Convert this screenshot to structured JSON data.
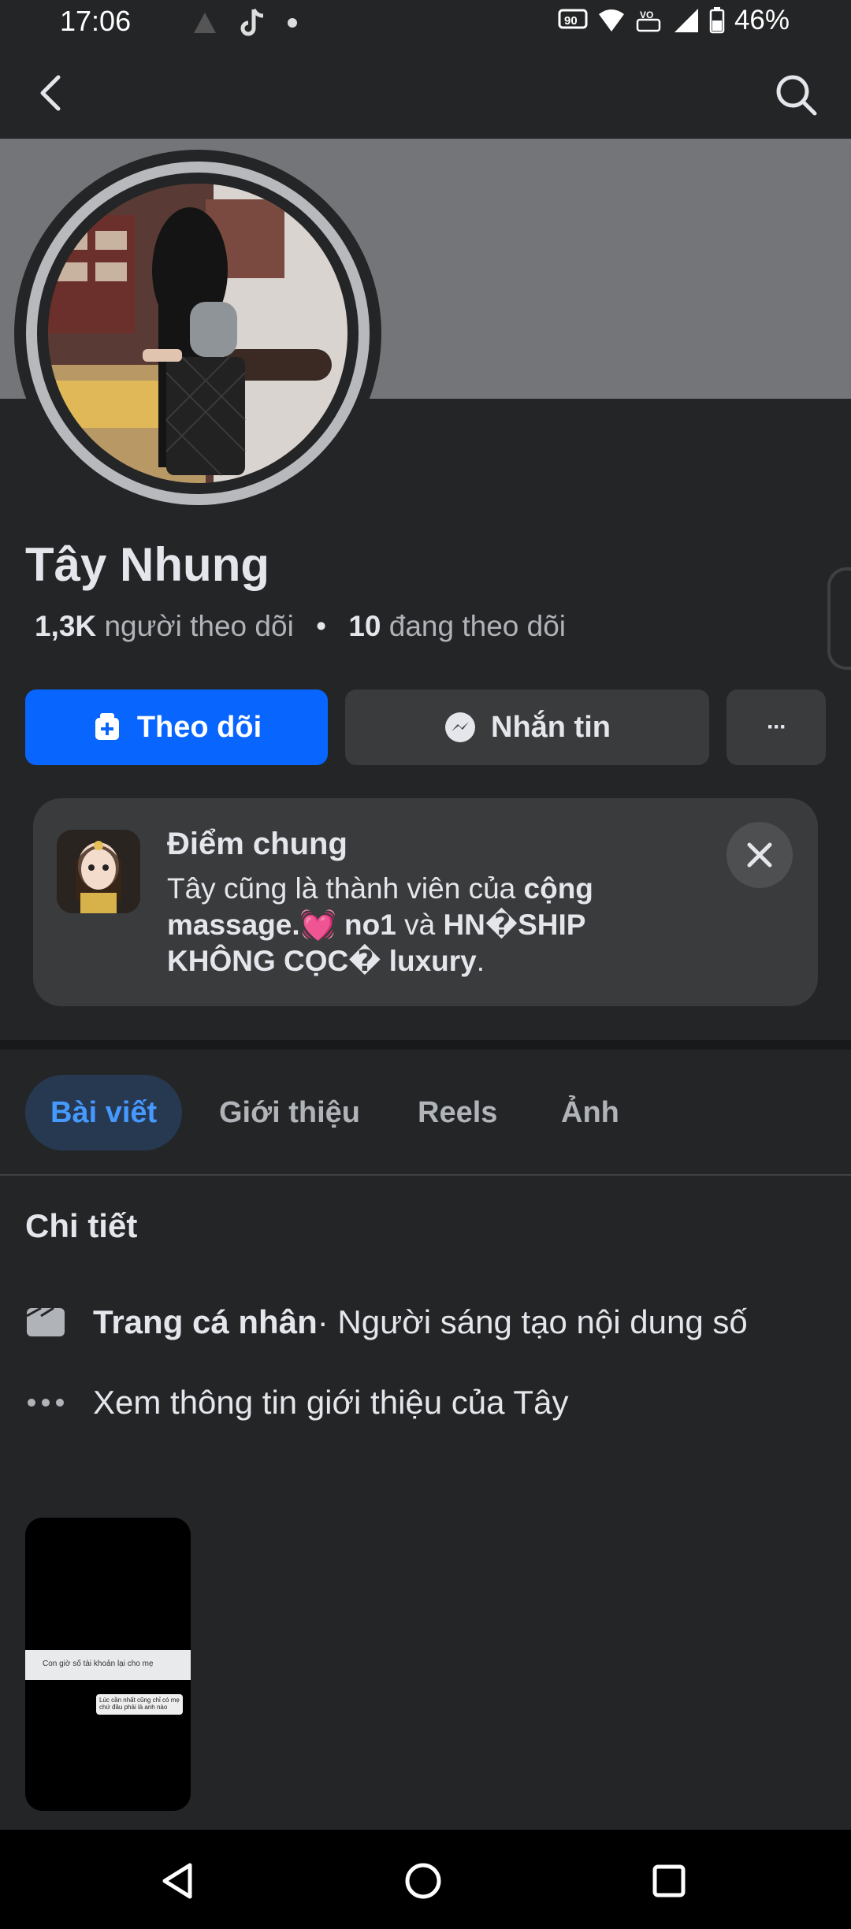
{
  "status_bar": {
    "time": "17:06",
    "battery": "46%",
    "left_icons": [
      "notification-icon",
      "tiktok-icon",
      "dot-icon"
    ],
    "right_icons": [
      "hd-voice-icon",
      "wifi-icon",
      "volte-icon",
      "signal-icon",
      "battery-icon"
    ]
  },
  "nav": {
    "back_icon": "back-arrow-icon",
    "search_icon": "search-icon"
  },
  "profile": {
    "name": "Tây Nhung",
    "followers_count": "1,3K",
    "followers_label": "người theo dõi",
    "separator": "•",
    "following_count": "10",
    "following_label": "đang theo dõi"
  },
  "actions": {
    "follow_label": "Theo dõi",
    "message_label": "Nhắn tin",
    "more_label": "···"
  },
  "mutual": {
    "title": "Điểm chung",
    "text_pre": "Tây cũng là thành viên của ",
    "group1": "cộng massage.💓 no1",
    "text_mid": " và ",
    "group2": "HN�SHIP KHÔNG CỌC� luxury",
    "text_end": "."
  },
  "tabs": [
    {
      "label": "Bài viết",
      "active": true
    },
    {
      "label": "Giới thiệu",
      "active": false
    },
    {
      "label": "Reels",
      "active": false
    },
    {
      "label": "Ảnh",
      "active": false
    }
  ],
  "details": {
    "title": "Chi tiết",
    "row1_bold": "Trang cá nhân",
    "row1_rest": " · Người sáng tạo nội dung số",
    "row2": "Xem thông tin giới thiệu của Tây"
  },
  "reel": {
    "line1": "Con giờ số tài khoản lại cho mẹ",
    "line2": "Lúc cần nhất cũng chỉ có mẹ chứ đâu phải là anh nào"
  },
  "colors": {
    "background": "#242526",
    "accent": "#0866ff",
    "active_tab_text": "#4599ff"
  }
}
